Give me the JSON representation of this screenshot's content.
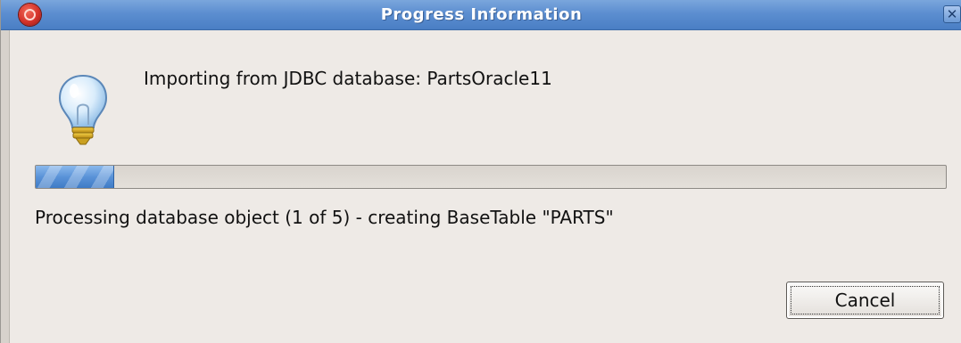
{
  "window": {
    "title": "Progress Information",
    "close_glyph": "✕",
    "app_icon": "app-logo-icon",
    "titlebar_color": "#5c8ed0"
  },
  "dialog": {
    "icon": "lightbulb-icon",
    "message": "Importing from JDBC database: PartsOracle11",
    "progress": {
      "fraction": 0.085,
      "color": "#5a93d8"
    },
    "status": "Processing database object (1 of 5) - creating BaseTable \"PARTS\"",
    "cancel_label": "Cancel"
  }
}
